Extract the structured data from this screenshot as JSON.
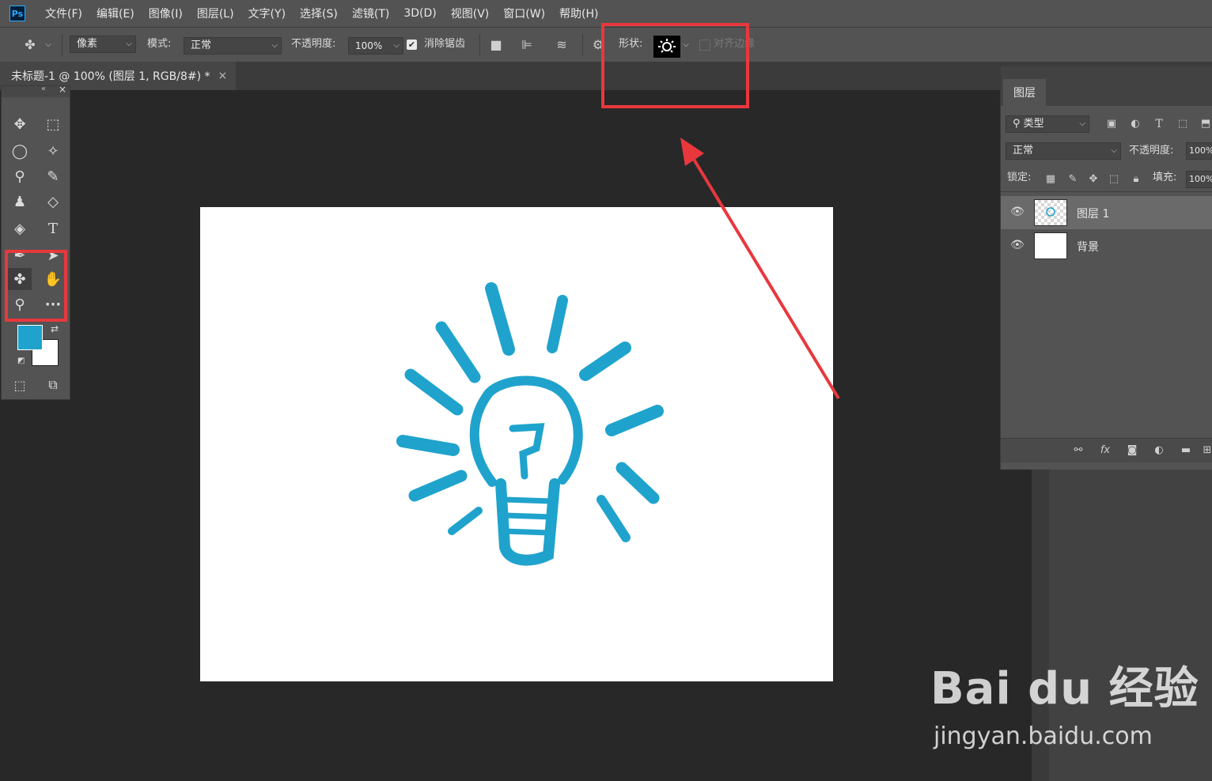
{
  "app": {
    "logo": "Ps"
  },
  "menu": [
    "文件(F)",
    "编辑(E)",
    "图像(I)",
    "图层(L)",
    "文字(Y)",
    "选择(S)",
    "滤镜(T)",
    "3D(D)",
    "视图(V)",
    "窗口(W)",
    "帮助(H)"
  ],
  "options": {
    "fill_type": "像素",
    "mode_label": "模式:",
    "mode_value": "正常",
    "opacity_label": "不透明度:",
    "opacity_value": "100%",
    "antialias_label": "消除锯齿",
    "shape_label": "形状:",
    "align_edges_label": "对齐边缘"
  },
  "document_tab": {
    "title": "未标题-1 @ 100% (图层 1, RGB/8#) *",
    "close": "×"
  },
  "colors": {
    "foreground": "#1fa3cc",
    "background": "#ffffff",
    "annotation": "#e8383d"
  },
  "layers_panel": {
    "tab": "图层",
    "filter_kind": "类型",
    "blend_mode": "正常",
    "opacity_label": "不透明度:",
    "opacity_value": "100%",
    "lock_label": "锁定:",
    "fill_label": "填充:",
    "fill_value": "100%",
    "layers": [
      {
        "name": "图层 1",
        "visible": true,
        "selected": true
      },
      {
        "name": "背景",
        "visible": true,
        "selected": false
      }
    ]
  },
  "watermark": {
    "logo": "Bai du 经验",
    "url": "jingyan.baidu.com"
  }
}
